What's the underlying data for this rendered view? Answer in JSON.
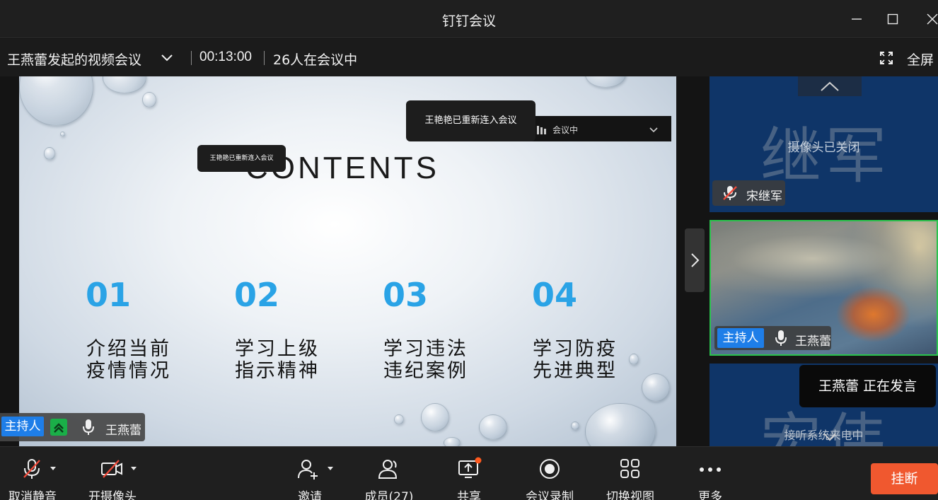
{
  "window": {
    "title": "钉钉会议",
    "controls": {
      "minimize": "—",
      "maximize": "☐",
      "close": "✕"
    }
  },
  "meeting": {
    "name": "王燕蕾发起的视频会议",
    "duration": "00:13:00",
    "participants_status": "26人在会议中",
    "fullscreen_label": "全屏"
  },
  "slide": {
    "heading": "CONTENTS",
    "items": [
      {
        "number": "01",
        "line1": "介绍当前",
        "line2": "疫情情况"
      },
      {
        "number": "02",
        "line1": "学习上级",
        "line2": "指示精神"
      },
      {
        "number": "03",
        "line1": "学习违法",
        "line2": "违纪案例"
      },
      {
        "number": "04",
        "line1": "学习防疫",
        "line2": "先进典型"
      }
    ]
  },
  "overlays": {
    "toast_small": "王艳艳已重新连入会议",
    "toast_big": "王艳艳已重新连入会议",
    "status_strip_text": "会议中"
  },
  "presenter": {
    "host_badge": "主持人",
    "name": "王燕蕾"
  },
  "sidebar": {
    "tile1": {
      "big_name": "继军",
      "camera_status": "摄像头已关闭",
      "name": "宋继军"
    },
    "tile2": {
      "host_badge": "主持人",
      "name": "王燕蕾"
    },
    "tile3": {
      "big_name": "宏伟",
      "status": "接听系统来电中"
    },
    "speaking_toast": "王燕蕾  正在发言"
  },
  "toolbar": {
    "unmute": "取消静音",
    "camera": "开摄像头",
    "invite": "邀请",
    "members": "成员(27)",
    "share": "共享",
    "record": "会议录制",
    "switch_view": "切换视图",
    "more": "更多",
    "hangup": "挂断"
  },
  "colors": {
    "accent_blue": "#1e7ee8",
    "slide_number": "#2aa3e6",
    "active_speaker_border": "#2bc34e",
    "hangup": "#f0582f",
    "share_badge": "#ff5a1f"
  }
}
